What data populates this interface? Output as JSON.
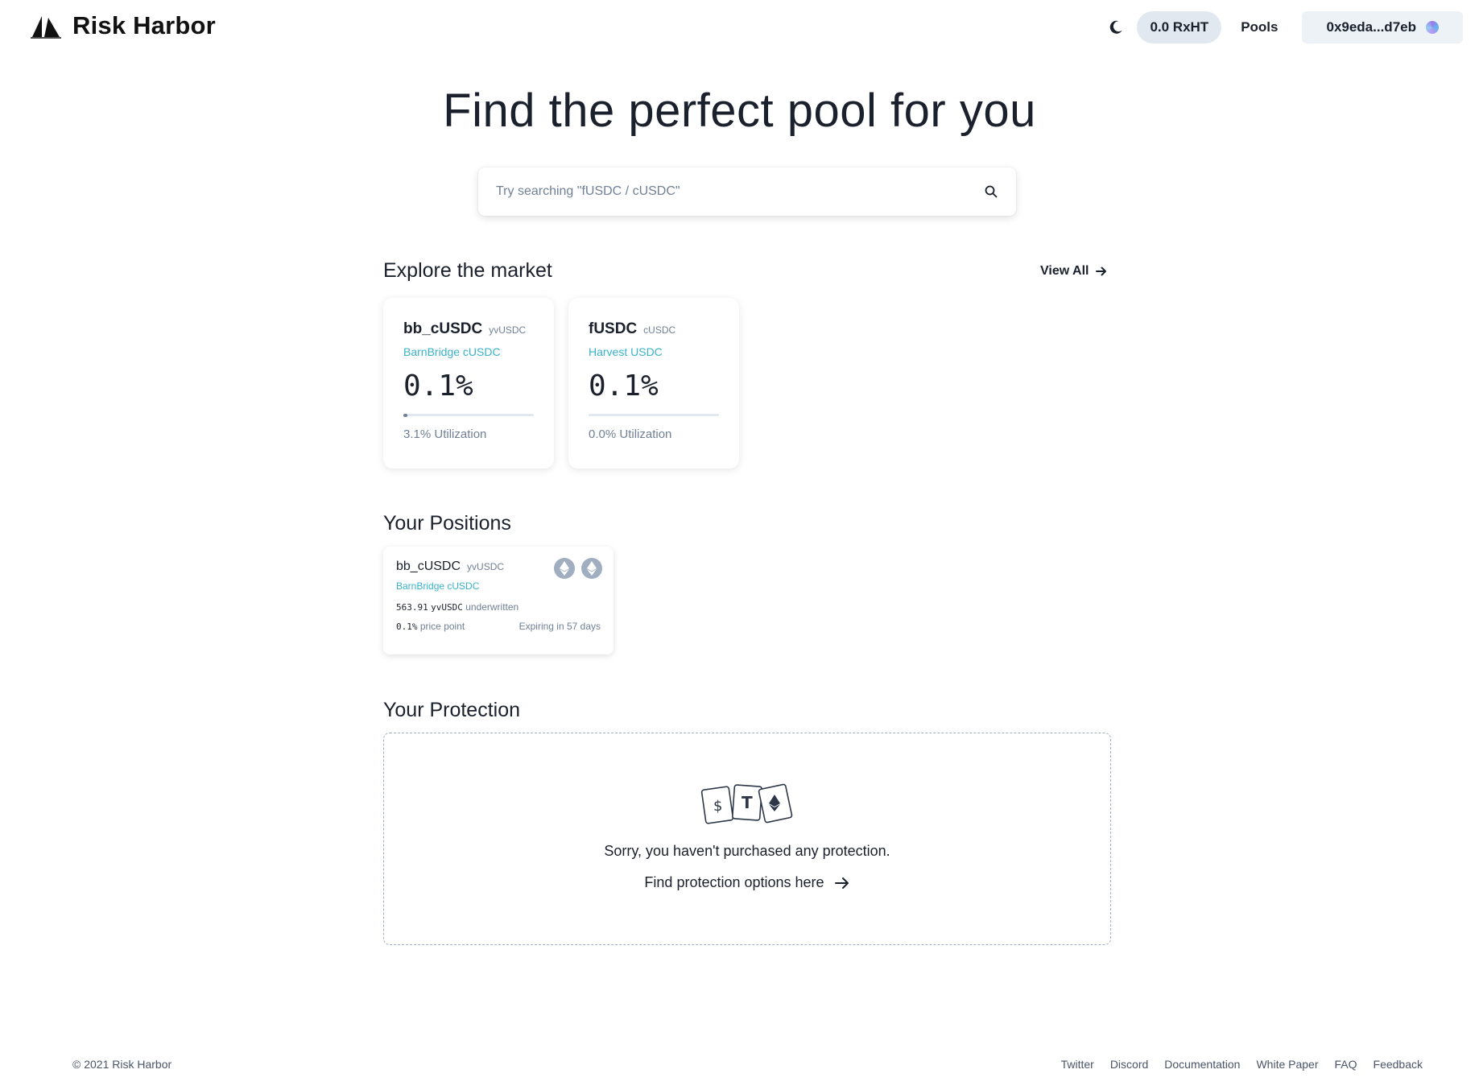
{
  "brand": {
    "name": "Risk Harbor"
  },
  "nav": {
    "token_balance": "0.0 RxHT",
    "pools_label": "Pools",
    "wallet_address": "0x9eda...d7eb"
  },
  "hero": {
    "title": "Find the perfect pool for you",
    "search_placeholder": "Try searching \"fUSDC / cUSDC\""
  },
  "market": {
    "title": "Explore the market",
    "view_all_label": "View All",
    "cards": [
      {
        "name": "bb_cUSDC",
        "asset": "yvUSDC",
        "protocol": "BarnBridge cUSDC",
        "price": "0.1%",
        "utilization_label": "3.1% Utilization",
        "utilization": 0.031
      },
      {
        "name": "fUSDC",
        "asset": "cUSDC",
        "protocol": "Harvest USDC",
        "price": "0.1%",
        "utilization_label": "0.0% Utilization",
        "utilization": 0.0
      }
    ]
  },
  "positions": {
    "title": "Your Positions",
    "items": [
      {
        "name": "bb_cUSDC",
        "asset": "yvUSDC",
        "protocol": "BarnBridge cUSDC",
        "amount": "563.91",
        "amount_asset": "yvUSDC",
        "amount_suffix": "underwritten",
        "price_point": "0.1%",
        "price_point_suffix": "price point",
        "expiry": "Expiring in 57 days"
      }
    ]
  },
  "protection": {
    "title": "Your Protection",
    "empty_message": "Sorry, you haven't purchased any protection.",
    "link_label": "Find protection options here"
  },
  "footer": {
    "copyright": "© 2021 Risk Harbor",
    "links": [
      "Twitter",
      "Discord",
      "Documentation",
      "White Paper",
      "FAQ",
      "Feedback"
    ]
  },
  "icons": {
    "logo": "sail-logo-icon",
    "theme": "moon-icon",
    "wallet": "wallet-avatar-icon",
    "search": "search-icon",
    "arrow": "arrow-right-icon",
    "coin": "ethereum-icon"
  },
  "colors": {
    "accent_link": "#38b2c9",
    "pill_bg": "#e2e8f0",
    "text": "#1a202c",
    "muted": "#718096"
  }
}
